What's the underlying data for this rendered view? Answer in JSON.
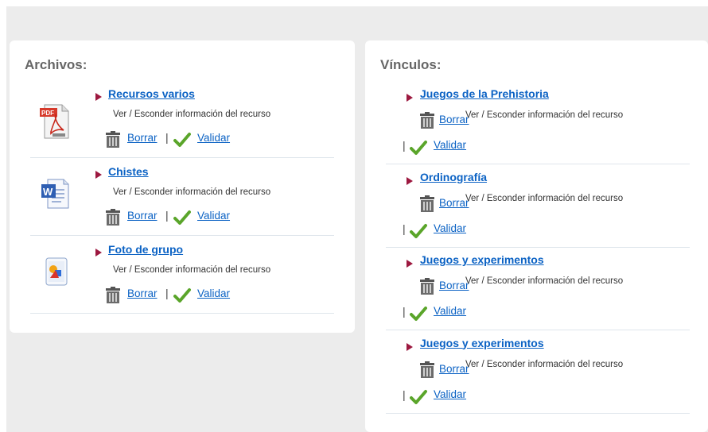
{
  "files_panel": {
    "title": "Archivos:",
    "items": [
      {
        "title": "Recursos varios",
        "icon": "pdf-file-icon",
        "info": "Ver / Esconder información del recurso",
        "delete": "Borrar",
        "validate": "Validar"
      },
      {
        "title": "Chistes",
        "icon": "word-document-icon",
        "info": "Ver / Esconder información del recurso",
        "delete": "Borrar",
        "validate": "Validar"
      },
      {
        "title": "Foto de grupo",
        "icon": "image-file-icon",
        "info": "Ver / Esconder información del recurso",
        "delete": "Borrar",
        "validate": "Validar"
      }
    ]
  },
  "links_panel": {
    "title": "Vínculos:",
    "items": [
      {
        "title": "Juegos de la Prehistoria",
        "info": "Ver / Esconder información del recurso",
        "delete": "Borrar",
        "validate": "Validar"
      },
      {
        "title": "Ordinografía",
        "info": "Ver / Esconder información del recurso",
        "delete": "Borrar",
        "validate": "Validar"
      },
      {
        "title": "Juegos y experimentos",
        "info": "Ver / Esconder información del recurso",
        "delete": "Borrar",
        "validate": "Validar"
      },
      {
        "title": "Juegos y experimentos",
        "info": "Ver / Esconder información del recurso",
        "delete": "Borrar",
        "validate": "Validar"
      }
    ]
  },
  "separator": "|",
  "colors": {
    "link": "#0b62c4",
    "bullet": "#9d1940",
    "check": "#5aa52a",
    "title": "#666666"
  }
}
